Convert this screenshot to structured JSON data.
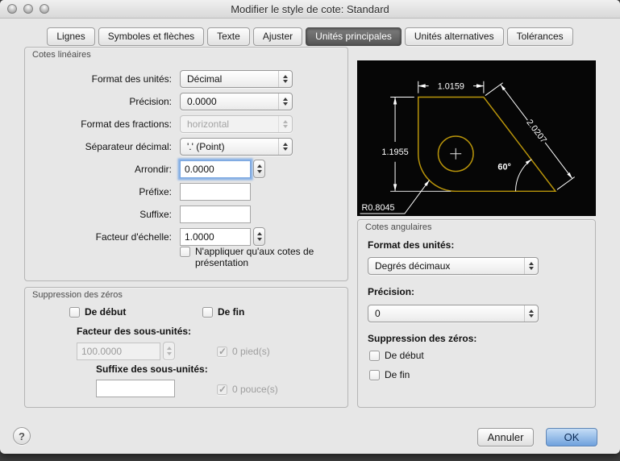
{
  "window": {
    "title": "Modifier le style de cote: Standard"
  },
  "tabs": [
    {
      "label": "Lignes"
    },
    {
      "label": "Symboles et flèches"
    },
    {
      "label": "Texte"
    },
    {
      "label": "Ajuster"
    },
    {
      "label": "Unités principales"
    },
    {
      "label": "Unités alternatives"
    },
    {
      "label": "Tolérances"
    }
  ],
  "active_tab": "Unités principales",
  "linear": {
    "title": "Cotes linéaires",
    "unit_format_label": "Format des unités:",
    "unit_format_value": "Décimal",
    "precision_label": "Précision:",
    "precision_value": "0.0000",
    "fraction_format_label": "Format des fractions:",
    "fraction_format_value": "horizontal",
    "decimal_sep_label": "Séparateur décimal:",
    "decimal_sep_value": "'.' (Point)",
    "round_label": "Arrondir:",
    "round_value": "0.0000",
    "prefix_label": "Préfixe:",
    "prefix_value": "",
    "suffix_label": "Suffixe:",
    "suffix_value": "",
    "scale_label": "Facteur d'échelle:",
    "scale_value": "1.0000",
    "layout_only_label": "N'appliquer qu'aux cotes de présentation"
  },
  "zeros": {
    "title": "Suppression des zéros",
    "leading_label": "De début",
    "trailing_label": "De fin",
    "subunit_factor_label": "Facteur des sous-unités:",
    "subunit_factor_value": "100.0000",
    "feet_label": "0 pied(s)",
    "subunit_suffix_label": "Suffixe des sous-unités:",
    "subunit_suffix_value": "",
    "inches_label": "0 pouce(s)"
  },
  "preview": {
    "dim_top": "1.0159",
    "dim_left": "1.1955",
    "dim_aligned": "2.0207",
    "dim_angle": "60°",
    "dim_radius": "R0.8045",
    "geometry_color": "#b8940a",
    "dim_color": "#ffffff",
    "background_color": "#060606"
  },
  "angular": {
    "title": "Cotes angulaires",
    "unit_format_label": "Format des unités:",
    "unit_format_value": "Degrés décimaux",
    "precision_label": "Précision:",
    "precision_value": "0",
    "zeros_label": "Suppression des zéros:",
    "leading_label": "De début",
    "trailing_label": "De fin"
  },
  "footer": {
    "help_label": "?",
    "cancel_label": "Annuler",
    "ok_label": "OK"
  }
}
